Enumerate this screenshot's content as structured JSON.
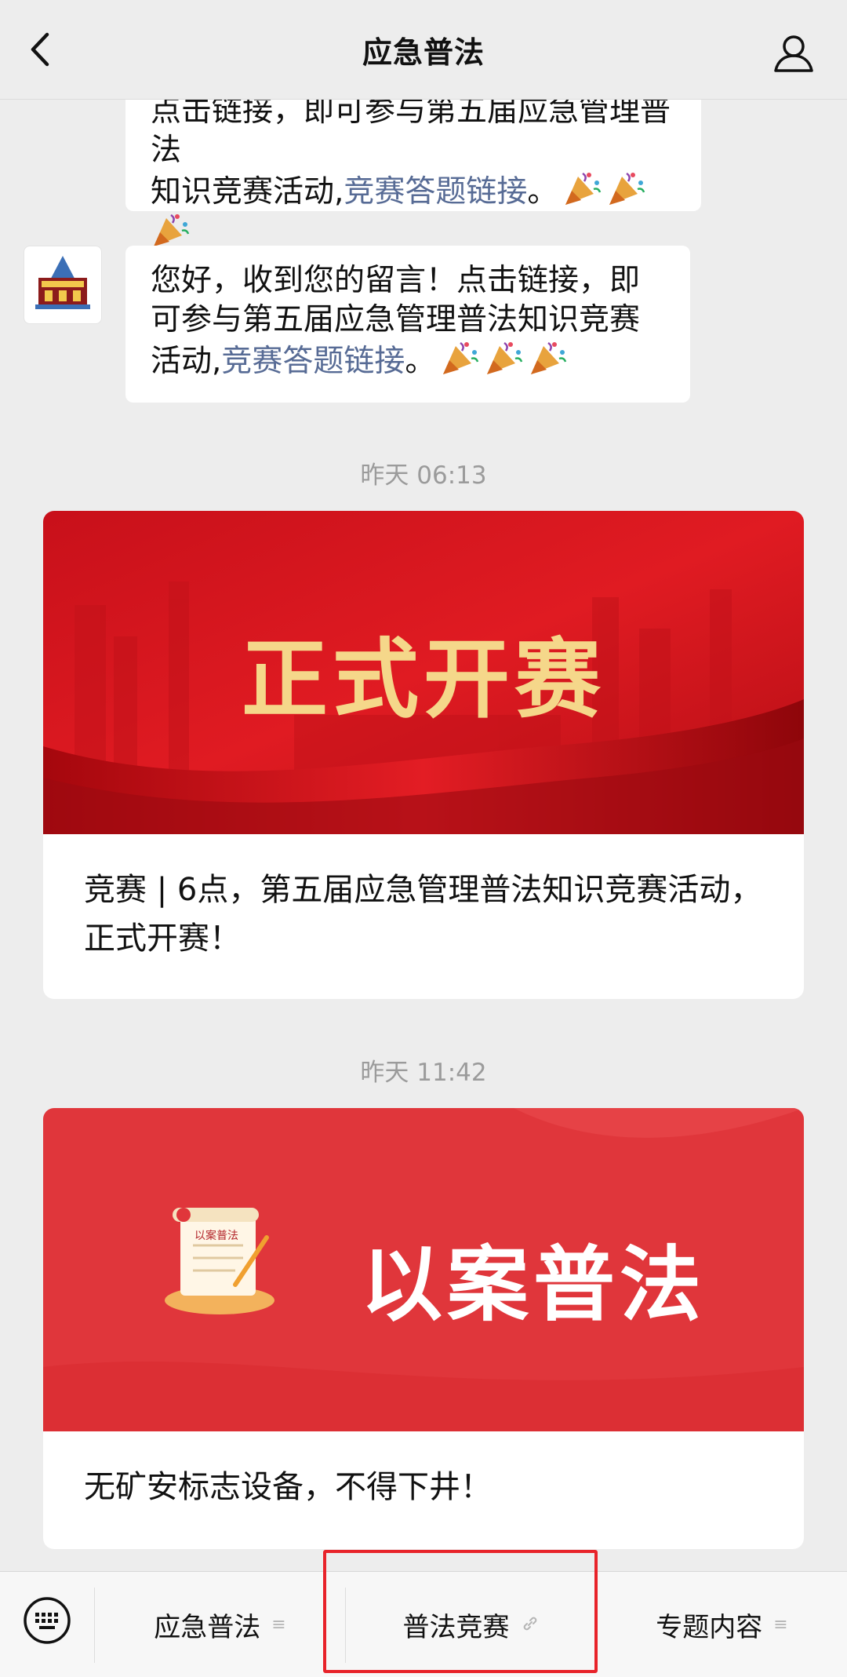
{
  "header": {
    "title": "应急普法",
    "back_icon": "chevron-left-icon",
    "profile_icon": "user-icon"
  },
  "messages": [
    {
      "partial_line": "点击链接，即可参与第五届应急管理普法",
      "text": "知识竞赛活动,",
      "link": "竞赛答题链接",
      "suffix": "。"
    },
    {
      "text": "您好，收到您的留言！点击链接，即可参与第五届应急管理普法知识竞赛活动,",
      "link": "竞赛答题链接",
      "suffix": "。"
    }
  ],
  "articles": [
    {
      "time": "昨天 06:13",
      "banner_text": "正式开赛",
      "title": "竞赛 | 6点，第五届应急管理普法知识竞赛活动，正式开赛！"
    },
    {
      "time": "昨天 11:42",
      "banner_text": "以案普法",
      "scroll_label": "以案普法",
      "title": "无矿安标志设备，不得下井！"
    }
  ],
  "bottom_menu": {
    "keyboard_icon": "keyboard-icon",
    "items": [
      {
        "label": "应急普法",
        "icon": "menu-icon"
      },
      {
        "label": "普法竞赛",
        "icon": "link-icon"
      },
      {
        "label": "专题内容",
        "icon": "menu-icon"
      }
    ]
  },
  "colors": {
    "link": "#576b95",
    "highlight_box": "#e8232a",
    "banner_red": "#d9141b"
  }
}
